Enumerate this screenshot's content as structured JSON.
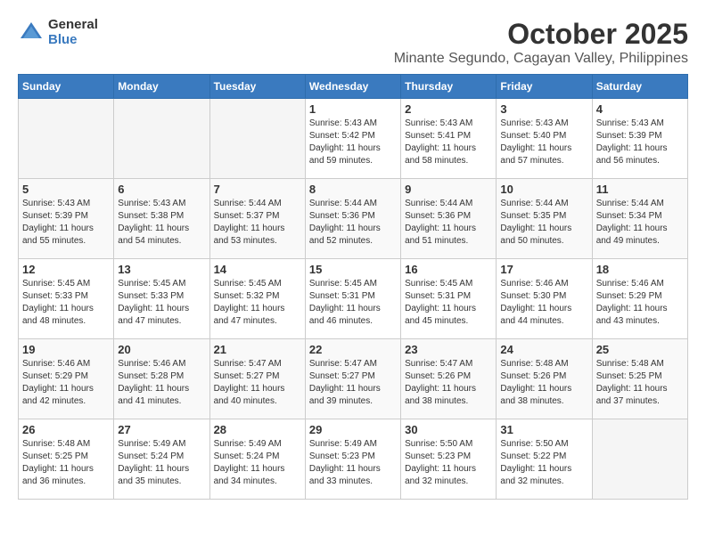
{
  "header": {
    "logo_general": "General",
    "logo_blue": "Blue",
    "title": "October 2025",
    "subtitle": "Minante Segundo, Cagayan Valley, Philippines"
  },
  "days_of_week": [
    "Sunday",
    "Monday",
    "Tuesday",
    "Wednesday",
    "Thursday",
    "Friday",
    "Saturday"
  ],
  "weeks": [
    [
      {
        "day": "",
        "content": ""
      },
      {
        "day": "",
        "content": ""
      },
      {
        "day": "",
        "content": ""
      },
      {
        "day": "1",
        "content": "Sunrise: 5:43 AM\nSunset: 5:42 PM\nDaylight: 11 hours\nand 59 minutes."
      },
      {
        "day": "2",
        "content": "Sunrise: 5:43 AM\nSunset: 5:41 PM\nDaylight: 11 hours\nand 58 minutes."
      },
      {
        "day": "3",
        "content": "Sunrise: 5:43 AM\nSunset: 5:40 PM\nDaylight: 11 hours\nand 57 minutes."
      },
      {
        "day": "4",
        "content": "Sunrise: 5:43 AM\nSunset: 5:39 PM\nDaylight: 11 hours\nand 56 minutes."
      }
    ],
    [
      {
        "day": "5",
        "content": "Sunrise: 5:43 AM\nSunset: 5:39 PM\nDaylight: 11 hours\nand 55 minutes."
      },
      {
        "day": "6",
        "content": "Sunrise: 5:43 AM\nSunset: 5:38 PM\nDaylight: 11 hours\nand 54 minutes."
      },
      {
        "day": "7",
        "content": "Sunrise: 5:44 AM\nSunset: 5:37 PM\nDaylight: 11 hours\nand 53 minutes."
      },
      {
        "day": "8",
        "content": "Sunrise: 5:44 AM\nSunset: 5:36 PM\nDaylight: 11 hours\nand 52 minutes."
      },
      {
        "day": "9",
        "content": "Sunrise: 5:44 AM\nSunset: 5:36 PM\nDaylight: 11 hours\nand 51 minutes."
      },
      {
        "day": "10",
        "content": "Sunrise: 5:44 AM\nSunset: 5:35 PM\nDaylight: 11 hours\nand 50 minutes."
      },
      {
        "day": "11",
        "content": "Sunrise: 5:44 AM\nSunset: 5:34 PM\nDaylight: 11 hours\nand 49 minutes."
      }
    ],
    [
      {
        "day": "12",
        "content": "Sunrise: 5:45 AM\nSunset: 5:33 PM\nDaylight: 11 hours\nand 48 minutes."
      },
      {
        "day": "13",
        "content": "Sunrise: 5:45 AM\nSunset: 5:33 PM\nDaylight: 11 hours\nand 47 minutes."
      },
      {
        "day": "14",
        "content": "Sunrise: 5:45 AM\nSunset: 5:32 PM\nDaylight: 11 hours\nand 47 minutes."
      },
      {
        "day": "15",
        "content": "Sunrise: 5:45 AM\nSunset: 5:31 PM\nDaylight: 11 hours\nand 46 minutes."
      },
      {
        "day": "16",
        "content": "Sunrise: 5:45 AM\nSunset: 5:31 PM\nDaylight: 11 hours\nand 45 minutes."
      },
      {
        "day": "17",
        "content": "Sunrise: 5:46 AM\nSunset: 5:30 PM\nDaylight: 11 hours\nand 44 minutes."
      },
      {
        "day": "18",
        "content": "Sunrise: 5:46 AM\nSunset: 5:29 PM\nDaylight: 11 hours\nand 43 minutes."
      }
    ],
    [
      {
        "day": "19",
        "content": "Sunrise: 5:46 AM\nSunset: 5:29 PM\nDaylight: 11 hours\nand 42 minutes."
      },
      {
        "day": "20",
        "content": "Sunrise: 5:46 AM\nSunset: 5:28 PM\nDaylight: 11 hours\nand 41 minutes."
      },
      {
        "day": "21",
        "content": "Sunrise: 5:47 AM\nSunset: 5:27 PM\nDaylight: 11 hours\nand 40 minutes."
      },
      {
        "day": "22",
        "content": "Sunrise: 5:47 AM\nSunset: 5:27 PM\nDaylight: 11 hours\nand 39 minutes."
      },
      {
        "day": "23",
        "content": "Sunrise: 5:47 AM\nSunset: 5:26 PM\nDaylight: 11 hours\nand 38 minutes."
      },
      {
        "day": "24",
        "content": "Sunrise: 5:48 AM\nSunset: 5:26 PM\nDaylight: 11 hours\nand 38 minutes."
      },
      {
        "day": "25",
        "content": "Sunrise: 5:48 AM\nSunset: 5:25 PM\nDaylight: 11 hours\nand 37 minutes."
      }
    ],
    [
      {
        "day": "26",
        "content": "Sunrise: 5:48 AM\nSunset: 5:25 PM\nDaylight: 11 hours\nand 36 minutes."
      },
      {
        "day": "27",
        "content": "Sunrise: 5:49 AM\nSunset: 5:24 PM\nDaylight: 11 hours\nand 35 minutes."
      },
      {
        "day": "28",
        "content": "Sunrise: 5:49 AM\nSunset: 5:24 PM\nDaylight: 11 hours\nand 34 minutes."
      },
      {
        "day": "29",
        "content": "Sunrise: 5:49 AM\nSunset: 5:23 PM\nDaylight: 11 hours\nand 33 minutes."
      },
      {
        "day": "30",
        "content": "Sunrise: 5:50 AM\nSunset: 5:23 PM\nDaylight: 11 hours\nand 32 minutes."
      },
      {
        "day": "31",
        "content": "Sunrise: 5:50 AM\nSunset: 5:22 PM\nDaylight: 11 hours\nand 32 minutes."
      },
      {
        "day": "",
        "content": ""
      }
    ]
  ]
}
